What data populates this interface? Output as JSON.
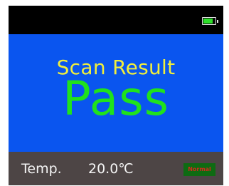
{
  "header": {
    "battery_icon": "battery-icon",
    "battery_level": 0.8,
    "battery_color": "#2ee02a"
  },
  "main": {
    "title": "Scan Result",
    "result": "Pass",
    "background_color": "#0a55ef",
    "title_color": "#f1ef3b",
    "result_color": "#20e21c"
  },
  "footer": {
    "temp_label": "Temp.",
    "temp_value": "20.0℃",
    "status_badge": "Normal",
    "badge_color": "#0e6b12"
  }
}
